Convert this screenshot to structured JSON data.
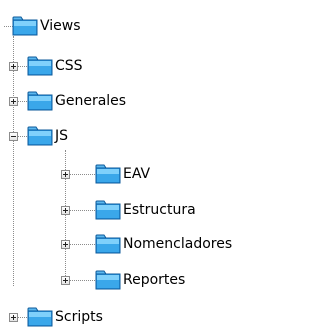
{
  "tree": {
    "root": {
      "label": "Views",
      "expanded": true,
      "icon": "folder-icon"
    },
    "children": [
      {
        "label": "CSS",
        "expanded": false,
        "icon": "folder-icon"
      },
      {
        "label": "Generales",
        "expanded": false,
        "icon": "folder-icon"
      },
      {
        "label": "JS",
        "expanded": true,
        "icon": "folder-icon",
        "children": [
          {
            "label": "EAV",
            "expanded": false,
            "icon": "folder-icon"
          },
          {
            "label": "Estructura",
            "expanded": false,
            "icon": "folder-icon"
          },
          {
            "label": "Nomencladores",
            "expanded": false,
            "icon": "folder-icon"
          },
          {
            "label": "Reportes",
            "expanded": false,
            "icon": "folder-icon"
          }
        ]
      },
      {
        "label": "Scripts",
        "expanded": false,
        "icon": "folder-icon"
      }
    ]
  },
  "colors": {
    "folder_fill": "#2a9ae6",
    "folder_top": "#7fd0fb",
    "folder_outline": "#0d5a9a",
    "connector": "#8c8c8c"
  }
}
